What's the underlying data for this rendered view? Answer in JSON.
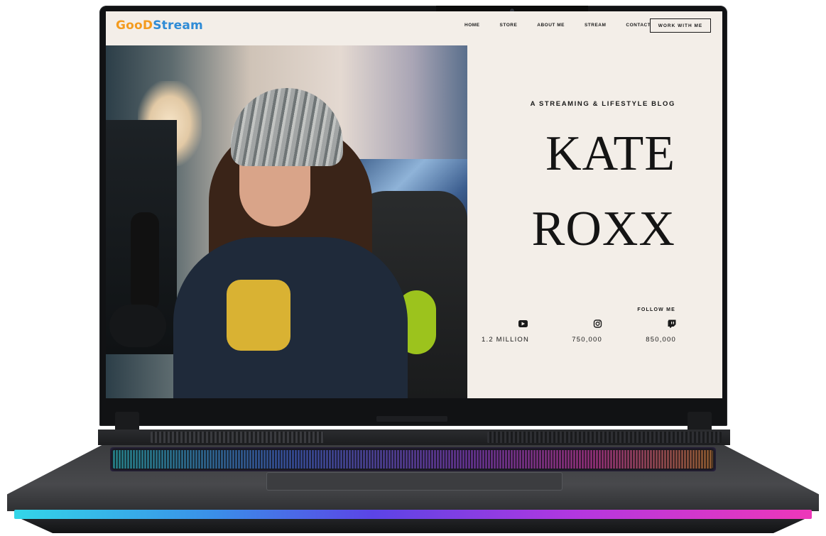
{
  "site": {
    "brand_parts": [
      "GooD",
      "Stream"
    ],
    "nav": [
      "HOME",
      "STORE",
      "ABOUT ME",
      "STREAM",
      "CONTACT"
    ],
    "cta": "WORK WITH ME"
  },
  "hero": {
    "tagline": "A STREAMING & LIFESTYLE BLOG",
    "name_line_1": "KATE",
    "name_line_2": "ROXX",
    "follow_label": "FOLLOW ME",
    "social": [
      {
        "icon": "youtube-icon",
        "count": "1.2 MILLION"
      },
      {
        "icon": "instagram-icon",
        "count": "750,000"
      },
      {
        "icon": "twitch-icon",
        "count": "850,000"
      }
    ]
  },
  "colors": {
    "page_bg": "#f3eee8",
    "brand_orange": "#f39b1f",
    "brand_blue": "#2e8bd6",
    "text": "#1a1a1a"
  }
}
